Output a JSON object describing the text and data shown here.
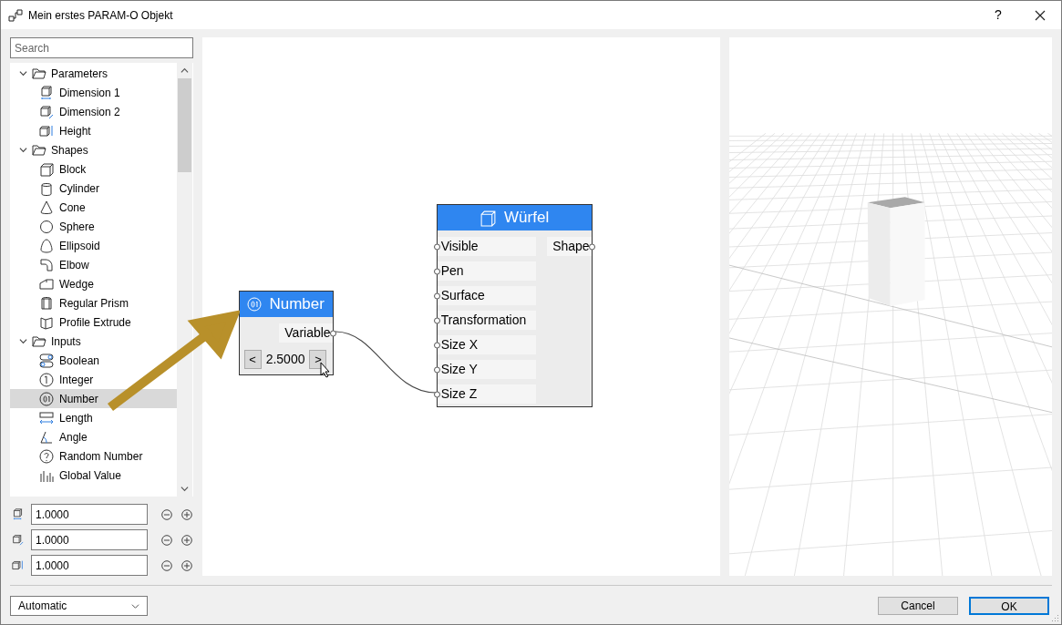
{
  "window": {
    "title": "Mein erstes PARAM-O Objekt",
    "help": "?"
  },
  "search": {
    "placeholder": "Search"
  },
  "tree": [
    {
      "label": "Parameters",
      "expanded": true,
      "selected": false,
      "children": [
        {
          "label": "Dimension 1",
          "selected": false
        },
        {
          "label": "Dimension 2",
          "selected": false
        },
        {
          "label": "Height",
          "selected": false
        }
      ]
    },
    {
      "label": "Shapes",
      "expanded": true,
      "selected": false,
      "children": [
        {
          "label": "Block",
          "selected": false
        },
        {
          "label": "Cylinder",
          "selected": false
        },
        {
          "label": "Cone",
          "selected": false
        },
        {
          "label": "Sphere",
          "selected": false
        },
        {
          "label": "Ellipsoid",
          "selected": false
        },
        {
          "label": "Elbow",
          "selected": false
        },
        {
          "label": "Wedge",
          "selected": false
        },
        {
          "label": "Regular Prism",
          "selected": false
        },
        {
          "label": "Profile Extrude",
          "selected": false
        }
      ]
    },
    {
      "label": "Inputs",
      "expanded": true,
      "selected": false,
      "children": [
        {
          "label": "Boolean",
          "selected": false
        },
        {
          "label": "Integer",
          "selected": false
        },
        {
          "label": "Number",
          "selected": true
        },
        {
          "label": "Length",
          "selected": false
        },
        {
          "label": "Angle",
          "selected": false
        },
        {
          "label": "Random Number",
          "selected": false
        },
        {
          "label": "Global Value",
          "selected": false
        }
      ]
    }
  ],
  "dimension_fields": [
    {
      "value": "1.0000"
    },
    {
      "value": "1.0000"
    },
    {
      "value": "1.0000"
    }
  ],
  "nodes": [
    {
      "title": "Number",
      "outputs": [
        "Variable"
      ],
      "stepper": {
        "prev": "<",
        "value": "2.5000",
        "next": ">"
      }
    },
    {
      "title": "Würfel",
      "inputs": [
        "Visible",
        "Pen",
        "Surface",
        "Transformation",
        "Size X",
        "Size Y",
        "Size Z"
      ],
      "outputs": [
        "Shape"
      ]
    }
  ],
  "mode_select": {
    "value": "Automatic"
  },
  "buttons": [
    {
      "label": "Cancel",
      "default": false
    },
    {
      "label": "OK",
      "default": true
    }
  ]
}
